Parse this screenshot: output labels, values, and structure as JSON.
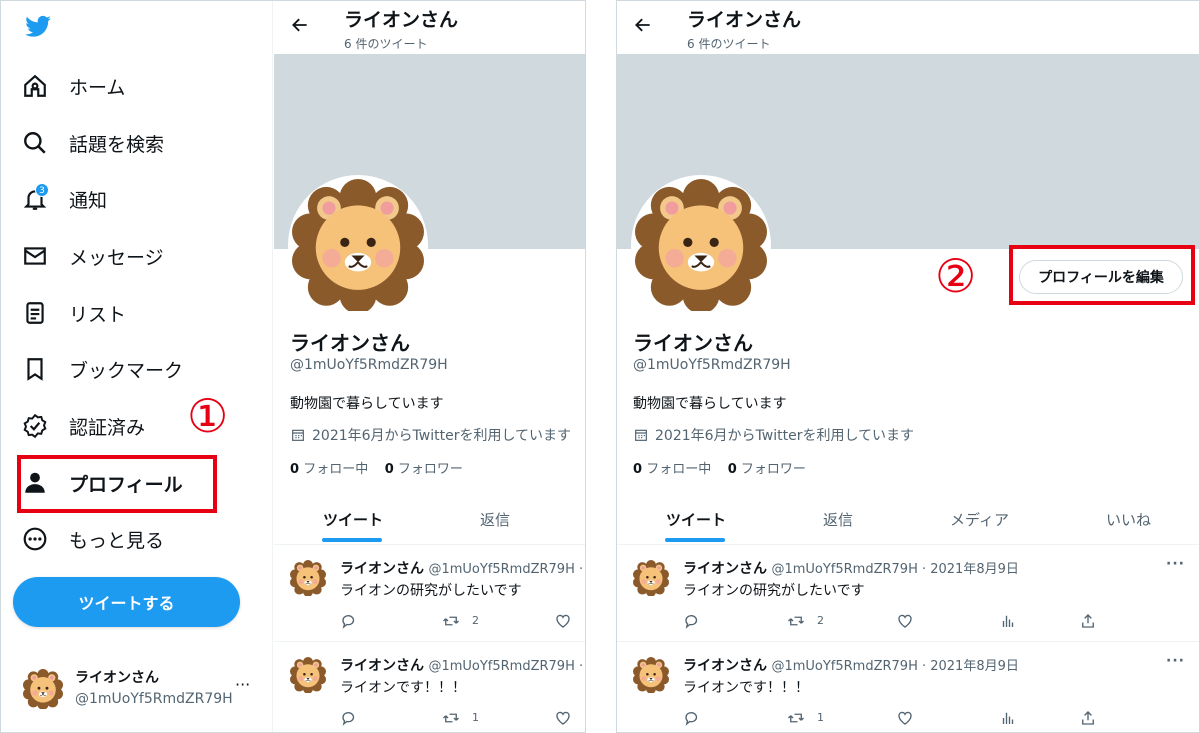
{
  "colors": {
    "accent": "#1d9bf0",
    "annotation": "#e60012",
    "banner": "#cfd9de"
  },
  "sidebar": {
    "logo": "twitter-bird-icon",
    "items": [
      {
        "label": "ホーム",
        "icon": "home-icon"
      },
      {
        "label": "話題を検索",
        "icon": "search-icon"
      },
      {
        "label": "通知",
        "icon": "bell-icon",
        "badge": "3"
      },
      {
        "label": "メッセージ",
        "icon": "envelope-icon"
      },
      {
        "label": "リスト",
        "icon": "list-icon"
      },
      {
        "label": "ブックマーク",
        "icon": "bookmark-icon"
      },
      {
        "label": "認証済み",
        "icon": "verified-icon"
      },
      {
        "label": "プロフィール",
        "icon": "person-icon"
      },
      {
        "label": "もっと見る",
        "icon": "more-circle-icon"
      }
    ],
    "tweet_button": "ツイートする",
    "account": {
      "name": "ライオンさん",
      "handle": "@1mUoYf5RmdZR79H",
      "more": "···"
    }
  },
  "annotations": {
    "step1": "①",
    "step2": "②"
  },
  "profile": {
    "top_name": "ライオンさん",
    "tweet_count": "6 件のツイート",
    "name": "ライオンさん",
    "handle": "@1mUoYf5RmdZR79H",
    "bio": "動物園で暮らしています",
    "joined": "2021年6月からTwitterを利用しています",
    "following_count": "0",
    "following_label": "フォロー中",
    "followers_count": "0",
    "followers_label": "フォロワー",
    "edit_button": "プロフィールを編集"
  },
  "tabs_left": [
    "ツイート",
    "返信"
  ],
  "tabs_right": [
    "ツイート",
    "返信",
    "メディア",
    "いいね"
  ],
  "tweets": [
    {
      "name": "ライオンさん",
      "handle_left": "@1mUoYf5RmdZR79H ·",
      "handle_right": "@1mUoYf5RmdZR79H · 2021年8月9日",
      "text": "ライオンの研究がしたいです",
      "retweets": "2",
      "more": "···"
    },
    {
      "name": "ライオンさん",
      "handle_left": "@1mUoYf5RmdZR79H ·",
      "handle_right": "@1mUoYf5RmdZR79H · 2021年8月9日",
      "text": "ライオンです！！！",
      "retweets": "1",
      "more": "···"
    }
  ]
}
